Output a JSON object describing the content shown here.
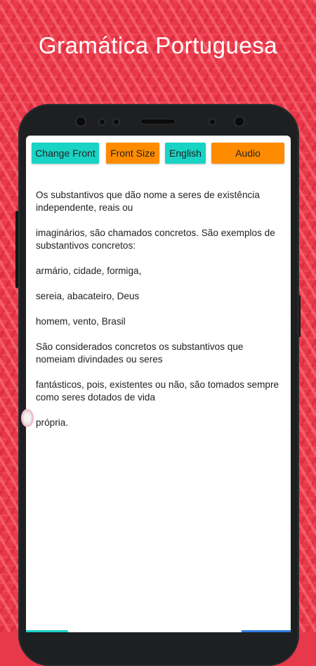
{
  "header": {
    "title": "Gramática Portuguesa"
  },
  "toolbar": {
    "change_front_label": "Change Front",
    "front_size_label": "Front Size",
    "english_label": "English",
    "audio_label": "Audio"
  },
  "colors": {
    "background": "#e8394a",
    "teal_button": "#19d3c5",
    "orange_button": "#ff8c00"
  },
  "content": {
    "paragraphs": [
      "Os substantivos que dão nome a seres de existência independente, reais ou",
      "imaginários, são chamados concretos. São exemplos de substantivos concretos:",
      "armário, cidade, formiga,",
      "sereia, abacateiro, Deus",
      "homem, vento, Brasil",
      "São considerados concretos os substantivos que nomeiam divindades ou seres",
      "fantásticos, pois, existentes ou não, são tomados sempre como seres dotados de vida",
      "própria."
    ]
  }
}
